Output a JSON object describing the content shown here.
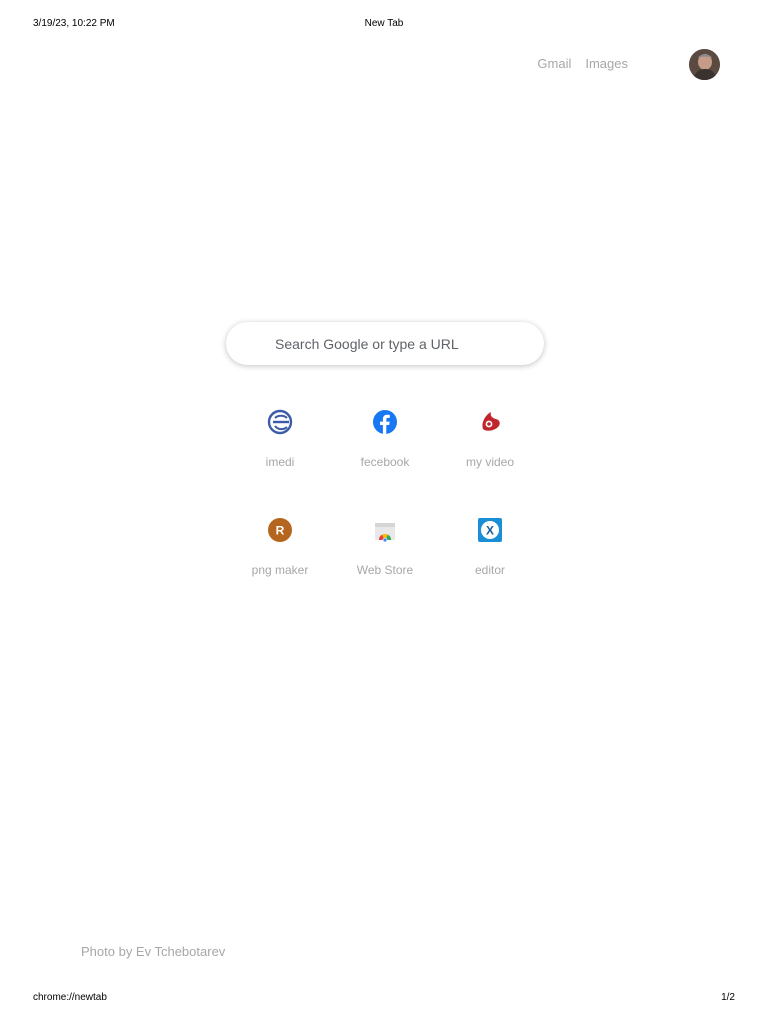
{
  "print_header": {
    "date": "3/19/23, 10:22 PM",
    "title": "New Tab"
  },
  "top_links": {
    "gmail": "Gmail",
    "images": "Images"
  },
  "search": {
    "placeholder": "Search Google or type a URL"
  },
  "shortcuts": [
    {
      "label": "imedi",
      "icon": "imedi-logo-icon"
    },
    {
      "label": "fecebook",
      "icon": "facebook-icon"
    },
    {
      "label": "my video",
      "icon": "myvideo-logo-icon"
    },
    {
      "label": "png maker",
      "icon": "letter-r-icon",
      "letter": "R"
    },
    {
      "label": "Web Store",
      "icon": "chrome-web-store-icon"
    },
    {
      "label": "editor",
      "icon": "x-editor-icon",
      "letter": "X"
    }
  ],
  "photo_credit": "Photo by Ev Tchebotarev",
  "print_footer": {
    "url": "chrome://newtab",
    "page": "1/2"
  },
  "colors": {
    "link_text": "#a7a7a7",
    "facebook_blue": "#1877f2",
    "imedi_blue": "#3c5ba8",
    "myvideo_red": "#c0272d",
    "png_maker_brown": "#b5651d",
    "editor_blue": "#1a8fd6"
  }
}
